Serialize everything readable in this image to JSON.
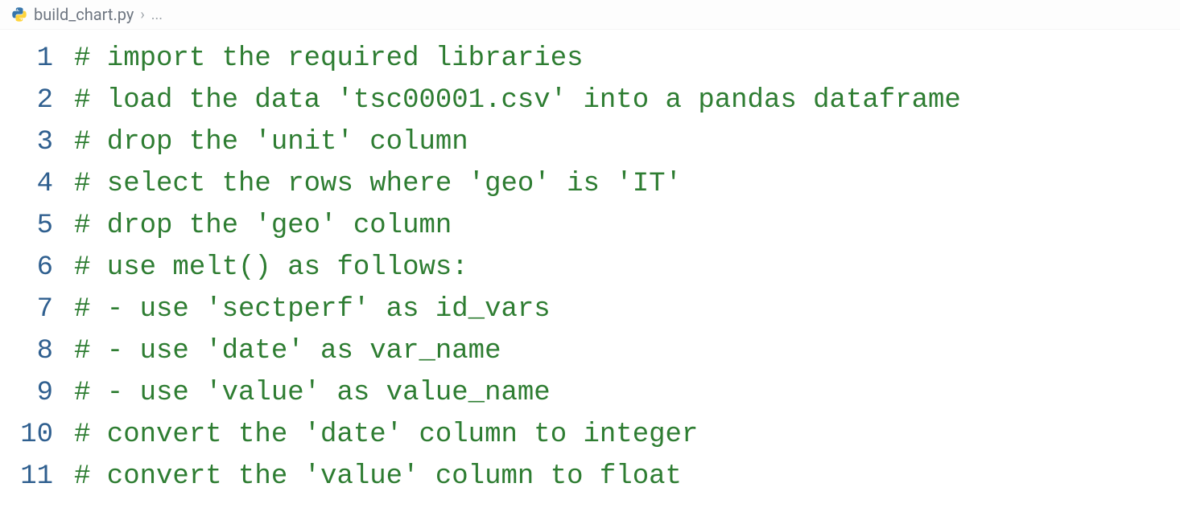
{
  "breadcrumb": {
    "file_icon": "python-icon",
    "file_name": "build_chart.py",
    "separator": "›",
    "more": "..."
  },
  "code": {
    "lines": [
      {
        "num": "1",
        "text": "# import the required libraries"
      },
      {
        "num": "2",
        "text": "# load the data 'tsc00001.csv' into a pandas dataframe"
      },
      {
        "num": "3",
        "text": "# drop the 'unit' column"
      },
      {
        "num": "4",
        "text": "# select the rows where 'geo' is 'IT'"
      },
      {
        "num": "5",
        "text": "# drop the 'geo' column"
      },
      {
        "num": "6",
        "text": "# use melt() as follows:"
      },
      {
        "num": "7",
        "text": "# - use 'sectperf' as id_vars"
      },
      {
        "num": "8",
        "text": "# - use 'date' as var_name"
      },
      {
        "num": "9",
        "text": "# - use 'value' as value_name"
      },
      {
        "num": "10",
        "text": "# convert the 'date' column to integer"
      },
      {
        "num": "11",
        "text": "# convert the 'value' column to float"
      }
    ]
  },
  "colors": {
    "comment": "#2E7D32",
    "line_number": "#2f5f8f",
    "breadcrumb_text": "#6e7681"
  }
}
